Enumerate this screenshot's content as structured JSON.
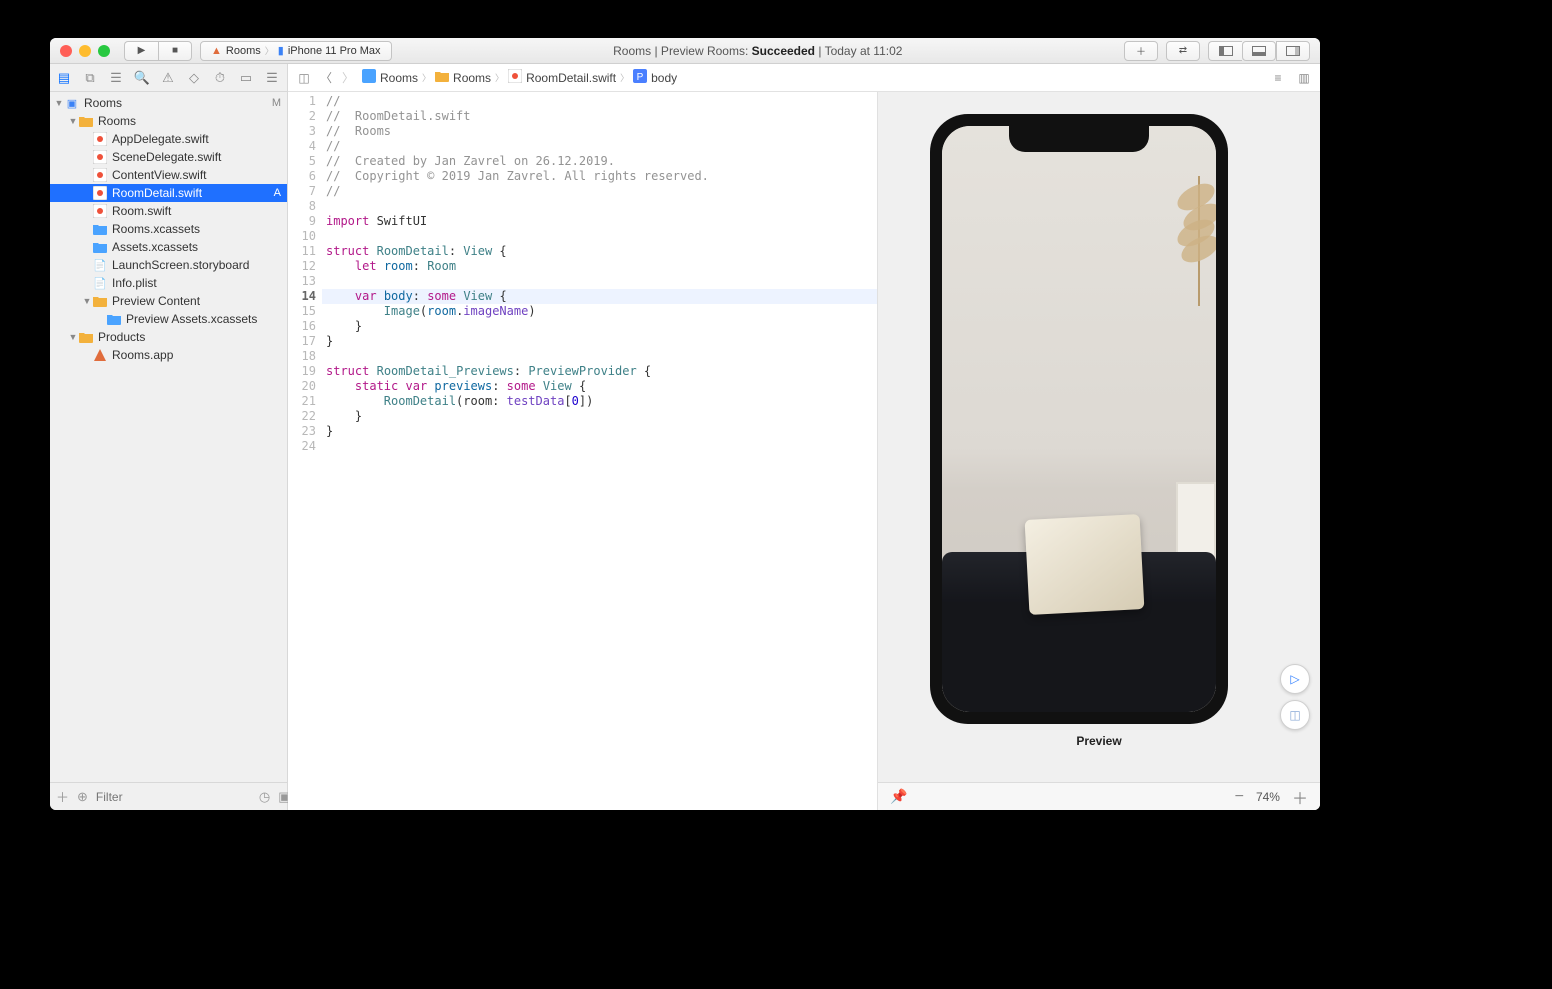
{
  "toolbar": {
    "scheme_target": "Rooms",
    "scheme_device": "iPhone 11 Pro Max",
    "status_prefix": "Rooms | Preview Rooms: ",
    "status_result": "Succeeded",
    "status_time": " | Today at 11:02"
  },
  "jumpbar": {
    "items": [
      "Rooms",
      "Rooms",
      "RoomDetail.swift",
      "body"
    ]
  },
  "navigator": {
    "filter_placeholder": "Filter",
    "root": {
      "label": "Rooms",
      "badge": "M"
    },
    "tree": [
      {
        "indent": 1,
        "type": "folder",
        "open": true,
        "label": "Rooms"
      },
      {
        "indent": 2,
        "type": "swift",
        "label": "AppDelegate.swift"
      },
      {
        "indent": 2,
        "type": "swift",
        "label": "SceneDelegate.swift"
      },
      {
        "indent": 2,
        "type": "swift",
        "label": "ContentView.swift"
      },
      {
        "indent": 2,
        "type": "swift",
        "label": "RoomDetail.swift",
        "selected": true,
        "badge": "A"
      },
      {
        "indent": 2,
        "type": "swift",
        "label": "Room.swift"
      },
      {
        "indent": 2,
        "type": "asset",
        "label": "Rooms.xcassets"
      },
      {
        "indent": 2,
        "type": "asset",
        "label": "Assets.xcassets"
      },
      {
        "indent": 2,
        "type": "storyboard",
        "label": "LaunchScreen.storyboard"
      },
      {
        "indent": 2,
        "type": "plist",
        "label": "Info.plist"
      },
      {
        "indent": 2,
        "type": "folder",
        "open": true,
        "label": "Preview Content"
      },
      {
        "indent": 3,
        "type": "asset",
        "label": "Preview Assets.xcassets"
      },
      {
        "indent": 1,
        "type": "folder",
        "open": true,
        "label": "Products"
      },
      {
        "indent": 2,
        "type": "app",
        "label": "Rooms.app"
      }
    ]
  },
  "code": {
    "current_line": 14,
    "lines": [
      [
        {
          "c": "tok-c",
          "t": "//"
        }
      ],
      [
        {
          "c": "tok-c",
          "t": "//  RoomDetail.swift"
        }
      ],
      [
        {
          "c": "tok-c",
          "t": "//  Rooms"
        }
      ],
      [
        {
          "c": "tok-c",
          "t": "//"
        }
      ],
      [
        {
          "c": "tok-c",
          "t": "//  Created by Jan Zavrel on 26.12.2019."
        }
      ],
      [
        {
          "c": "tok-c",
          "t": "//  Copyright © 2019 Jan Zavrel. All rights reserved."
        }
      ],
      [
        {
          "c": "tok-c",
          "t": "//"
        }
      ],
      [],
      [
        {
          "c": "tok-k",
          "t": "import"
        },
        {
          "t": " SwiftUI"
        }
      ],
      [],
      [
        {
          "c": "tok-k",
          "t": "struct"
        },
        {
          "t": " "
        },
        {
          "c": "tok-t",
          "t": "RoomDetail"
        },
        {
          "t": ": "
        },
        {
          "c": "tok-t",
          "t": "View"
        },
        {
          "t": " {"
        }
      ],
      [
        {
          "t": "    "
        },
        {
          "c": "tok-k",
          "t": "let"
        },
        {
          "t": " "
        },
        {
          "c": "tok-f",
          "t": "room"
        },
        {
          "t": ": "
        },
        {
          "c": "tok-t",
          "t": "Room"
        }
      ],
      [],
      [
        {
          "t": "    "
        },
        {
          "c": "tok-k",
          "t": "var"
        },
        {
          "t": " "
        },
        {
          "c": "tok-f",
          "t": "body"
        },
        {
          "t": ": "
        },
        {
          "c": "tok-k",
          "t": "some"
        },
        {
          "t": " "
        },
        {
          "c": "tok-t",
          "t": "View"
        },
        {
          "t": " {"
        }
      ],
      [
        {
          "t": "        "
        },
        {
          "c": "tok-t",
          "t": "Image"
        },
        {
          "t": "("
        },
        {
          "c": "tok-f",
          "t": "room"
        },
        {
          "t": "."
        },
        {
          "c": "tok-p",
          "t": "imageName"
        },
        {
          "t": ")"
        }
      ],
      [
        {
          "t": "    }"
        }
      ],
      [
        {
          "t": "}"
        }
      ],
      [],
      [
        {
          "c": "tok-k",
          "t": "struct"
        },
        {
          "t": " "
        },
        {
          "c": "tok-t",
          "t": "RoomDetail_Previews"
        },
        {
          "t": ": "
        },
        {
          "c": "tok-t",
          "t": "PreviewProvider"
        },
        {
          "t": " {"
        }
      ],
      [
        {
          "t": "    "
        },
        {
          "c": "tok-k",
          "t": "static"
        },
        {
          "t": " "
        },
        {
          "c": "tok-k",
          "t": "var"
        },
        {
          "t": " "
        },
        {
          "c": "tok-f",
          "t": "previews"
        },
        {
          "t": ": "
        },
        {
          "c": "tok-k",
          "t": "some"
        },
        {
          "t": " "
        },
        {
          "c": "tok-t",
          "t": "View"
        },
        {
          "t": " {"
        }
      ],
      [
        {
          "t": "        "
        },
        {
          "c": "tok-t",
          "t": "RoomDetail"
        },
        {
          "t": "(room: "
        },
        {
          "c": "tok-p",
          "t": "testData"
        },
        {
          "t": "["
        },
        {
          "c": "tok-n",
          "t": "0"
        },
        {
          "t": "])"
        }
      ],
      [
        {
          "t": "    }"
        }
      ],
      [
        {
          "t": "}"
        }
      ],
      []
    ]
  },
  "canvas": {
    "preview_label": "Preview",
    "zoom": "74%"
  }
}
